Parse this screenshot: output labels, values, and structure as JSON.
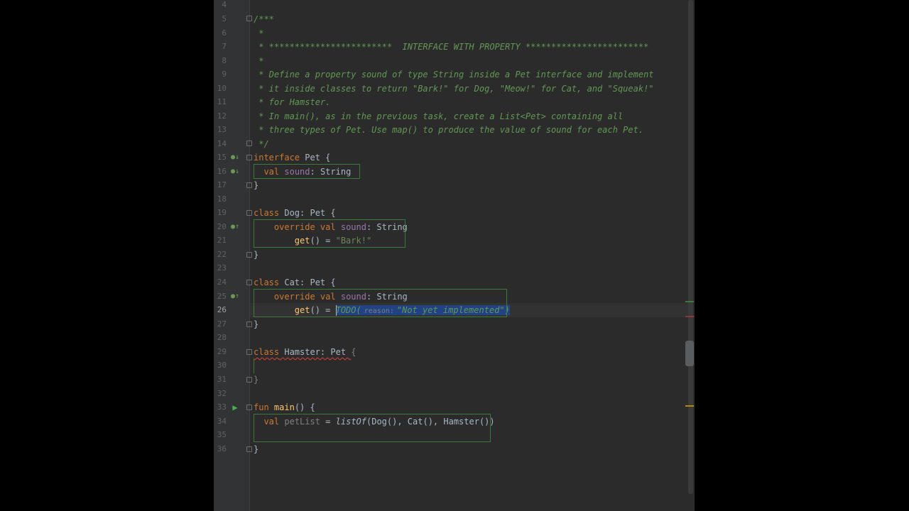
{
  "colors": {
    "background": "#2b2b2b",
    "gutter": "#313335",
    "keyword": "#cc7832",
    "doc_comment": "#629755",
    "property": "#9876aa",
    "string": "#6a8759",
    "function": "#ffc66d",
    "selection": "#214283"
  },
  "gutter": {
    "line_numbers": [
      "4",
      "5",
      "6",
      "7",
      "8",
      "9",
      "10",
      "11",
      "12",
      "13",
      "14",
      "15",
      "16",
      "17",
      "18",
      "19",
      "20",
      "21",
      "22",
      "23",
      "24",
      "25",
      "26",
      "27",
      "28",
      "29",
      "30",
      "31",
      "32",
      "33",
      "34",
      "35",
      "36"
    ]
  },
  "code": {
    "l5": "/***",
    "l6": " *",
    "l7": " * ************************  INTERFACE WITH PROPERTY ************************",
    "l8": " *",
    "l9": " * Define a property sound of type String inside a Pet interface and implement",
    "l10": " * it inside classes to return \"Bark!\" for Dog, \"Meow!\" for Cat, and \"Squeak!\"",
    "l11": " * for Hamster.",
    "l12": " * In main(), as in the previous task, create a List<Pet> containing all",
    "l13": " * three types of Pet. Use map() to produce the value of sound for each Pet.",
    "l14": " */",
    "l15": {
      "kw": "interface",
      "name": " Pet {"
    },
    "l16": {
      "kw": "val",
      "prop": "sound",
      "rest": ": String"
    },
    "l17": "}",
    "l19": {
      "kw": "class",
      "name": " Dog: Pet {"
    },
    "l20": {
      "kw": "override val",
      "prop": "sound",
      "rest": ": String"
    },
    "l21": {
      "fn": "get",
      "rest": "() = ",
      "str": "\"Bark!\""
    },
    "l22": "}",
    "l24": {
      "kw": "class",
      "name": " Cat: Pet {"
    },
    "l25": {
      "kw": "override val",
      "prop": "sound",
      "rest": ": String"
    },
    "l26": {
      "fn": "get",
      "rest": "() = ",
      "todo": "TODO(",
      "hint": "reason:",
      "str": "\"Not yet implemented\"",
      "close": ")"
    },
    "l27": "}",
    "l29": {
      "kw": "class",
      "name": " Hamster: Pet ",
      "brace": "{"
    },
    "l31": "}",
    "l33": {
      "kw": "fun",
      "fn": "main",
      "rest": "() {"
    },
    "l34": {
      "kw": "val",
      "var": "petList",
      "eq": " = ",
      "fn": "listOf",
      "rest": "(Dog(), Cat(), Hamster())"
    },
    "l36": "}"
  },
  "icons": {
    "implemented": "implemented-icon",
    "implementing": "implementing-icon",
    "run": "run-icon"
  }
}
